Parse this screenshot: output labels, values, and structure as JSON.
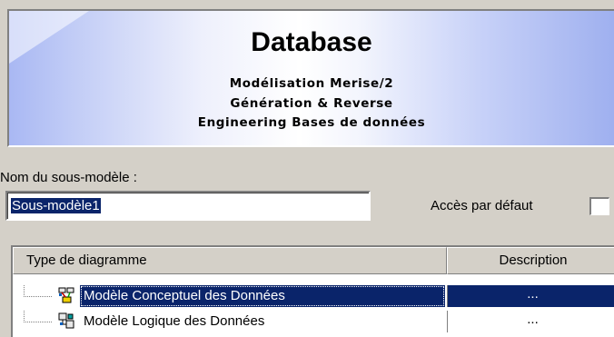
{
  "banner": {
    "title": "Database",
    "line1": "Modélisation Merise/2",
    "line2": "Génération & Reverse",
    "line3": "Engineering Bases de données"
  },
  "form": {
    "name_label": "Nom du sous-modèle :",
    "name_value": "Sous-modèle1",
    "access_label": "Accès par défaut",
    "access_checked": false
  },
  "table": {
    "headers": {
      "type": "Type de diagramme",
      "description": "Description"
    },
    "rows": [
      {
        "type": "Modèle Conceptuel des Données",
        "description": "...",
        "icon": "mcd-diagram-icon",
        "selected": true
      },
      {
        "type": "Modèle Logique des Données",
        "description": "...",
        "icon": "mld-diagram-icon",
        "selected": false
      }
    ]
  },
  "colors": {
    "selection": "#0a246a",
    "dialog_bg": "#d4d0c8",
    "banner_accent": "#a9b8f3"
  }
}
